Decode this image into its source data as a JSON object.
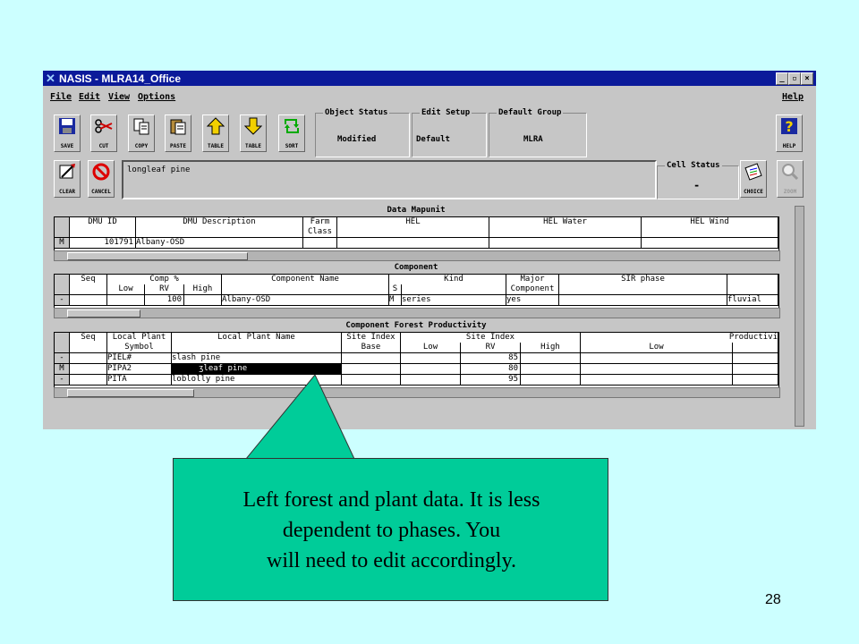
{
  "window": {
    "title": "NASIS - MLRA14_Office",
    "controls": {
      "min": "_",
      "max": "▫",
      "close": "×"
    }
  },
  "menu": {
    "file": "File",
    "edit": "Edit",
    "view": "View",
    "options": "Options",
    "help": "Help"
  },
  "toolbar": {
    "save": "SAVE",
    "cut": "CUT",
    "copy": "COPY",
    "paste": "PASTE",
    "table_up": "TABLE",
    "table_down": "TABLE",
    "sort": "SORT",
    "clear": "CLEAR",
    "cancel": "CANCEL",
    "choice": "CHOICE",
    "zoom": "ZOOM",
    "help": "HELP"
  },
  "status": {
    "object_status_title": "Object Status",
    "object_status_value": "Modified",
    "edit_setup_title": "Edit Setup",
    "edit_setup_value": "Default",
    "default_group_title": "Default Group",
    "default_group_value": "MLRA",
    "cell_status_title": "Cell Status",
    "cell_status_value": "-"
  },
  "edit_field": {
    "value": "longleaf pine"
  },
  "data_mapunit": {
    "title": "Data Mapunit",
    "headers": {
      "dmu_id": "DMU ID",
      "dmu_desc": "DMU Description",
      "farm1": "Farm",
      "farm2": "Class",
      "hel": "HEL",
      "hel_water": "HEL Water",
      "hel_wind": "HEL Wind"
    },
    "row": {
      "mark": "M",
      "dmu_id": "101791",
      "dmu_desc": "Albany-OSD"
    }
  },
  "component": {
    "title": "Component",
    "headers": {
      "seq": "Seq",
      "comp_pct": "Comp %",
      "low": "Low",
      "rv": "RV",
      "high": "High",
      "comp_name": "Component Name",
      "s": "S",
      "kind": "Kind",
      "major1": "Major",
      "major2": "Component",
      "sir": "SIR phase"
    },
    "row": {
      "mark": "-",
      "rv": "100",
      "comp_name": "Albany-OSD",
      "s": "M",
      "kind": "series",
      "major": "yes",
      "extra": "fluvial"
    }
  },
  "forest": {
    "title": "Component Forest Productivity",
    "headers": {
      "seq": "Seq",
      "lp1": "Local Plant",
      "lp2": "Symbol",
      "lpname": "Local Plant Name",
      "si1": "Site Index",
      "si2": "Base",
      "site_index": "Site Index",
      "low": "Low",
      "rv": "RV",
      "high": "High",
      "low2": "Low",
      "prod": "Productivi"
    },
    "rows": [
      {
        "mark": "-",
        "symbol": "PIEL#",
        "name": "slash pine",
        "rv": "85"
      },
      {
        "mark": "M",
        "symbol": "PIPA2",
        "name": "ʒleaf pine",
        "rv": "80"
      },
      {
        "mark": "-",
        "symbol": "PITA",
        "name": "loblolly pine",
        "rv": "95"
      }
    ]
  },
  "callout": {
    "line1": "Left forest and plant data. It is less",
    "line2": "dependent to phases. You",
    "line3": "will need to edit accordingly."
  },
  "slide_number": "28"
}
